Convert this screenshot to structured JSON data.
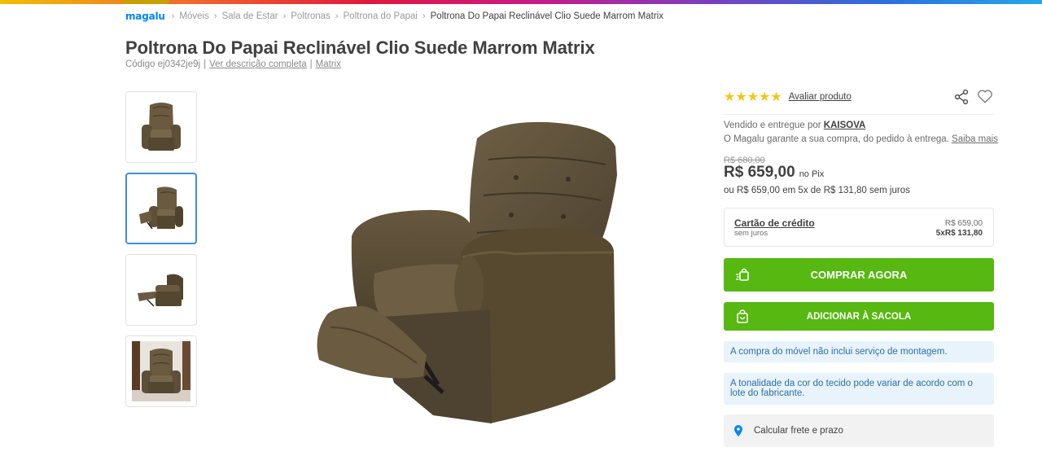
{
  "brand": {
    "logo_text": "magalu",
    "accent": "#0086ff",
    "buy_green": "#56b810"
  },
  "breadcrumb": {
    "items": [
      "Móveis",
      "Sala de Estar",
      "Poltronas",
      "Poltrona do Papai"
    ],
    "current": "Poltrona Do Papai Reclinável Clio Suede Marrom Matrix",
    "separator": "›"
  },
  "product": {
    "title": "Poltrona Do Papai Reclinável Clio Suede Marrom Matrix",
    "code": "Código ej0342je9j",
    "description_link": "Ver descrição completa",
    "brand_link": "Matrix"
  },
  "gallery": {
    "thumbnails": [
      "front-upright",
      "front-reclined",
      "side-reclined",
      "room-scene"
    ],
    "selected_index": 1,
    "main_image": "reclined armchair brown suede"
  },
  "rating": {
    "stars": "★★★★★",
    "stars_count": 5,
    "rate_link": "Avaliar produto"
  },
  "seller": {
    "prefix": "Vendido e entregue por",
    "name": "KAISOVA",
    "guarantee": "O Magalu garante a sua compra, do pedido à entrega.",
    "more_link": "Saiba mais"
  },
  "pricing": {
    "old_price": "R$ 680,00",
    "price": "R$ 659,00",
    "price_suffix": "no Pix",
    "installments": "ou R$ 659,00 em 5x de R$ 131,80 sem juros"
  },
  "credit_card": {
    "label": "Cartão de crédito",
    "sub": "sem juros",
    "total": "R$ 659,00",
    "installment": "5xR$ 131,80"
  },
  "actions": {
    "buy_now": "COMPRAR AGORA",
    "add_to_bag": "ADICIONAR À SACOLA"
  },
  "notices": [
    "A compra do móvel não inclui serviço de montagem.",
    "A tonalidade da cor do tecido pode variar de acordo com o lote do fabricante."
  ],
  "shipping": {
    "label": "Calcular frete e prazo"
  }
}
